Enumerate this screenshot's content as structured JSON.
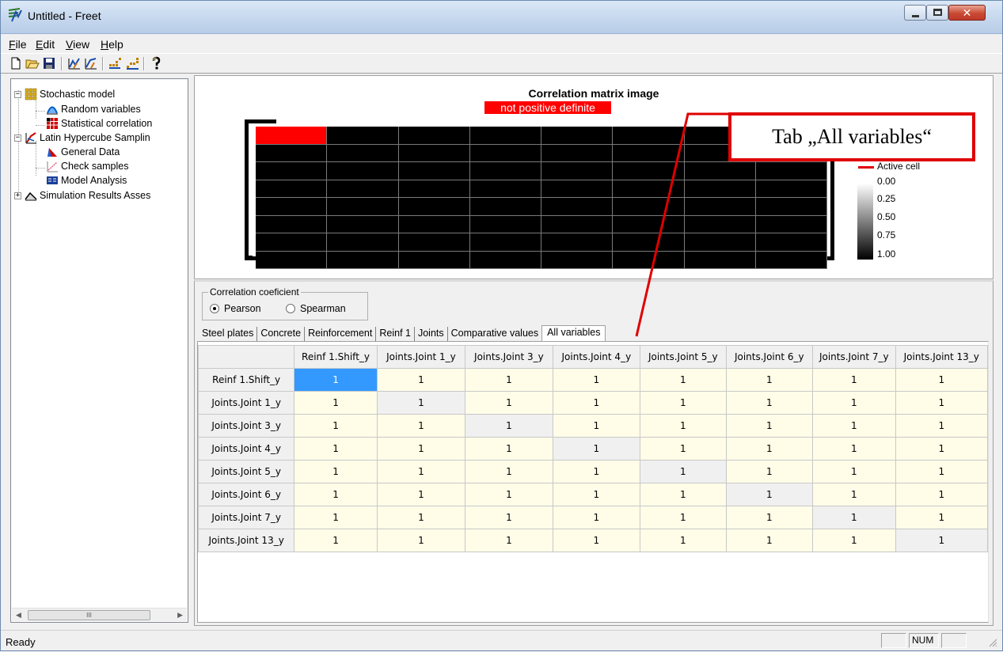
{
  "window": {
    "title": "Untitled - Freet",
    "icon": "freet-app-icon",
    "controls": [
      "minimize",
      "maximize",
      "close"
    ]
  },
  "menubar": {
    "items": [
      {
        "label": "File",
        "mnemonic": "F"
      },
      {
        "label": "Edit",
        "mnemonic": "E"
      },
      {
        "label": "View",
        "mnemonic": "V"
      },
      {
        "label": "Help",
        "mnemonic": "H"
      }
    ]
  },
  "toolbar": {
    "buttons": [
      "new-icon",
      "open-icon",
      "save-icon",
      "chart-icon",
      "chart2-icon",
      "grid-icon",
      "grid2-icon",
      "help-icon"
    ]
  },
  "tree": {
    "items": [
      {
        "label": "Stochastic model",
        "icon": "stochastic-model-icon",
        "level": 0,
        "expander": "−"
      },
      {
        "label": "Random variables",
        "icon": "random-variables-icon",
        "level": 1
      },
      {
        "label": "Statistical correlation",
        "icon": "statistical-correlation-icon",
        "level": 1
      },
      {
        "label": "Latin Hypercube Samplin",
        "icon": "lhs-icon",
        "level": 0,
        "expander": "−"
      },
      {
        "label": "General Data",
        "icon": "general-data-icon",
        "level": 1
      },
      {
        "label": "Check samples",
        "icon": "check-samples-icon",
        "level": 1
      },
      {
        "label": "Model Analysis",
        "icon": "model-analysis-icon",
        "level": 1
      },
      {
        "label": "Simulation Results Asses",
        "icon": "simulation-results-icon",
        "level": 0,
        "expander": "+"
      }
    ],
    "scroll_thumb": "III"
  },
  "matrix_panel": {
    "title": "Correlation matrix image",
    "status_badge": "not positive definite",
    "size": 8,
    "active_cell": [
      0,
      0
    ],
    "legend": {
      "active_label": "Active cell",
      "scale_labels": [
        "0.00",
        "0.25",
        "0.50",
        "0.75",
        "1.00"
      ]
    },
    "colors": {
      "active": "#ff0000",
      "value_one": "#000000",
      "badge": "#ff0000"
    }
  },
  "annotation": {
    "text": "Tab „All variables“",
    "color": "#e00000"
  },
  "coefficient": {
    "legend": "Correlation coeficient",
    "options": [
      {
        "label": "Pearson",
        "checked": true
      },
      {
        "label": "Spearman",
        "checked": false
      }
    ]
  },
  "tabs": [
    {
      "label": "Steel plates",
      "active": false
    },
    {
      "label": "Concrete",
      "active": false
    },
    {
      "label": "Reinforcement",
      "active": false
    },
    {
      "label": "Reinf 1",
      "active": false
    },
    {
      "label": "Joints",
      "active": false
    },
    {
      "label": "Comparative values",
      "active": false
    },
    {
      "label": "All variables",
      "active": true
    }
  ],
  "grid": {
    "columns": [
      "Reinf 1.Shift_y",
      "Joints.Joint 1_y",
      "Joints.Joint 3_y",
      "Joints.Joint 4_y",
      "Joints.Joint 5_y",
      "Joints.Joint 6_y",
      "Joints.Joint 7_y",
      "Joints.Joint 13_y"
    ],
    "rows": [
      {
        "header": "Reinf 1.Shift_y",
        "values": [
          "1",
          "1",
          "1",
          "1",
          "1",
          "1",
          "1",
          "1"
        ]
      },
      {
        "header": "Joints.Joint 1_y",
        "values": [
          "1",
          "1",
          "1",
          "1",
          "1",
          "1",
          "1",
          "1"
        ]
      },
      {
        "header": "Joints.Joint 3_y",
        "values": [
          "1",
          "1",
          "1",
          "1",
          "1",
          "1",
          "1",
          "1"
        ]
      },
      {
        "header": "Joints.Joint 4_y",
        "values": [
          "1",
          "1",
          "1",
          "1",
          "1",
          "1",
          "1",
          "1"
        ]
      },
      {
        "header": "Joints.Joint 5_y",
        "values": [
          "1",
          "1",
          "1",
          "1",
          "1",
          "1",
          "1",
          "1"
        ]
      },
      {
        "header": "Joints.Joint 6_y",
        "values": [
          "1",
          "1",
          "1",
          "1",
          "1",
          "1",
          "1",
          "1"
        ]
      },
      {
        "header": "Joints.Joint 7_y",
        "values": [
          "1",
          "1",
          "1",
          "1",
          "1",
          "1",
          "1",
          "1"
        ]
      },
      {
        "header": "Joints.Joint 13_y",
        "values": [
          "1",
          "1",
          "1",
          "1",
          "1",
          "1",
          "1",
          "1"
        ]
      }
    ],
    "selected_cell": [
      0,
      0
    ],
    "colors": {
      "cell": "#fffde8",
      "diagonal": "#f0f0f0",
      "selected": "#3399ff"
    }
  },
  "statusbar": {
    "text": "Ready",
    "panes": [
      "",
      "NUM",
      ""
    ]
  }
}
